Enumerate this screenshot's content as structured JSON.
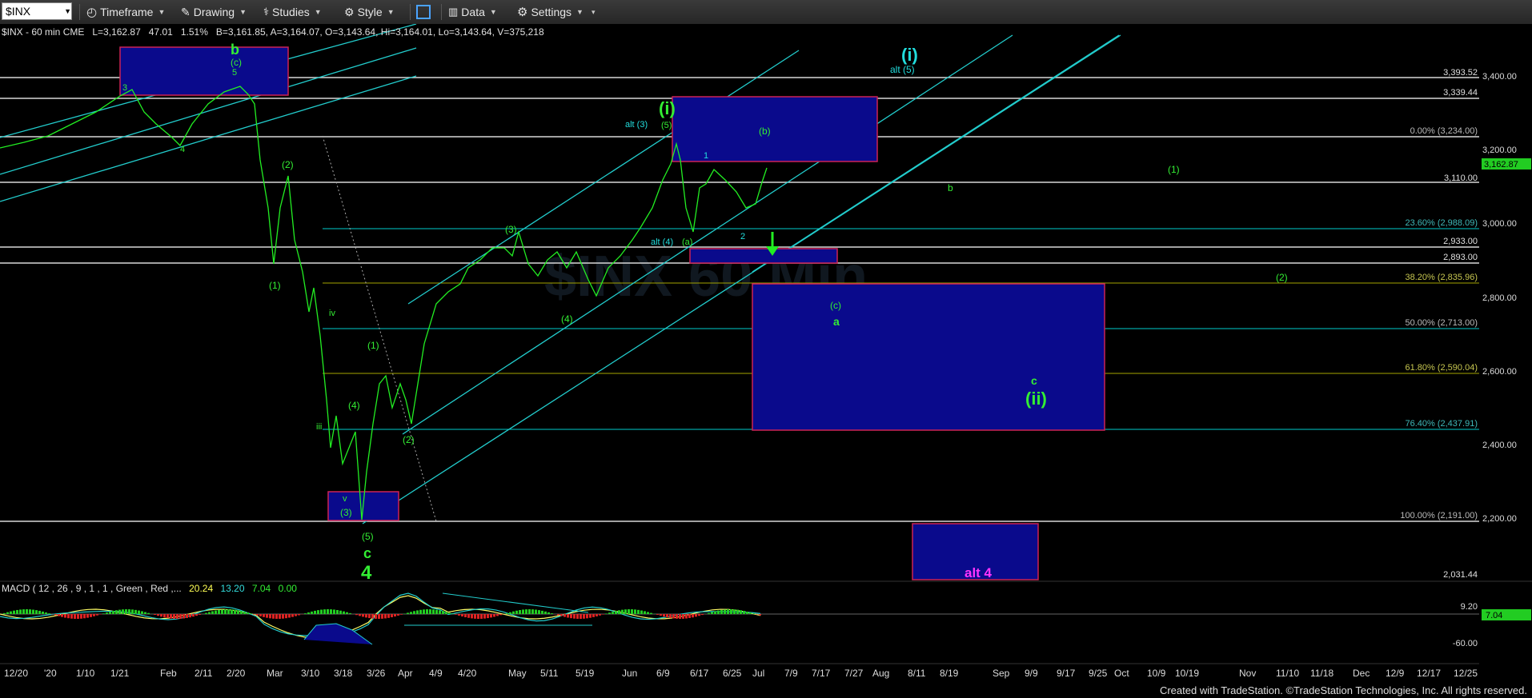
{
  "toolbar": {
    "symbol": "$INX",
    "menus": [
      {
        "id": "timeframe",
        "label": "Timeframe",
        "icon": "clock-icon"
      },
      {
        "id": "drawing",
        "label": "Drawing",
        "icon": "pencil-icon"
      },
      {
        "id": "studies",
        "label": "Studies",
        "icon": "studies-icon"
      },
      {
        "id": "style",
        "label": "Style",
        "icon": "style-icon"
      },
      {
        "id": "data",
        "label": "Data",
        "icon": "data-icon"
      },
      {
        "id": "settings",
        "label": "Settings",
        "icon": "gear-icon"
      }
    ]
  },
  "quote": {
    "symbol": "$INX - 60 min CME",
    "last": "L=3,162.87",
    "change": "47.01",
    "pct": "1.51%",
    "bid": "B=3,161.85",
    "ask": "A=3,164.07",
    "open": "O=3,143.64",
    "high": "Hi=3,164.01",
    "low": "Lo=3,143.64",
    "volume": "V=375,218"
  },
  "macd": {
    "label": "MACD ( 12 , 26 , 9 , 1 , 1 , Green , Red ,...",
    "v1": "20.24",
    "v2": "13.20",
    "v3": "7.04",
    "v4": "0.00",
    "axis": [
      "9.20",
      "-60.00"
    ],
    "current": "7.04"
  },
  "y_axis": {
    "ticks": [
      "3,400.00",
      "3,200.00",
      "3,000.00",
      "2,800.00",
      "2,600.00",
      "2,400.00",
      "2,200.00"
    ],
    "current": "3,162.87",
    "levels": [
      {
        "label": "3,393.52"
      },
      {
        "label": "3,339.44"
      },
      {
        "label": "3,110.00"
      },
      {
        "label": "2,933.00"
      },
      {
        "label": "2,893.00"
      },
      {
        "label": "2,031.44"
      }
    ],
    "fib": [
      {
        "label": "0.00% (3,234.00)"
      },
      {
        "label": "23.60% (2,988.09)"
      },
      {
        "label": "38.20% (2,835.96)"
      },
      {
        "label": "50.00% (2,713.00)"
      },
      {
        "label": "61.80% (2,590.04)"
      },
      {
        "label": "76.40% (2,437.91)"
      },
      {
        "label": "100.00% (2,191.00)"
      }
    ]
  },
  "x_axis": {
    "labels": [
      "12/20",
      "'20",
      "1/10",
      "1/21",
      "Feb",
      "2/11",
      "2/20",
      "Mar",
      "3/10",
      "3/18",
      "3/26",
      "Apr",
      "4/9",
      "4/20",
      "May",
      "5/11",
      "5/19",
      "Jun",
      "6/9",
      "6/17",
      "6/25",
      "Jul",
      "7/9",
      "7/17",
      "7/27",
      "Aug",
      "8/11",
      "8/19",
      "Sep",
      "9/9",
      "9/17",
      "9/25",
      "Oct",
      "10/9",
      "10/19",
      "Nov",
      "11/10",
      "11/18",
      "Dec",
      "12/9",
      "12/17",
      "12/25"
    ]
  },
  "wave_labels": {
    "b_major": "b",
    "c_paren": "(c)",
    "five": "5",
    "three": "3",
    "four": "4",
    "two_paren": "(2)",
    "one_paren": "(1)",
    "iv": "iv",
    "iii": "iii",
    "v": "v",
    "three_paren": "(3)",
    "five_paren": "(5)",
    "c_major": "c",
    "four_major": "4",
    "one_paren_b": "(1)",
    "four_paren": "(4)",
    "two_paren_b": "(2)",
    "three_paren_b": "(3)",
    "four_paren_b": "(4)",
    "i_major": "(i)",
    "alt3": "alt (3)",
    "five_paren_b": "(5)",
    "b_paren": "(b)",
    "one": "1",
    "two": "2",
    "alt4": "alt (4)",
    "a_paren": "(a)",
    "i_top": "(i)",
    "alt5": "alt (5)",
    "b_small": "b",
    "one_paren_c": "(1)",
    "two_paren_c": "(2)",
    "c_paren_b": "(c)",
    "a_small": "a",
    "c_small": "c",
    "ii_major": "(ii)",
    "alt4_box": "alt 4"
  },
  "footer": "Created with TradeStation. ©TradeStation Technologies, Inc. All rights reserved.",
  "colors": {
    "accent": "#00ffff",
    "wave_green": "#33ee33",
    "magenta": "#ff33ff",
    "box_fill": "#0a0a8c",
    "box_border": "#cc2255"
  }
}
